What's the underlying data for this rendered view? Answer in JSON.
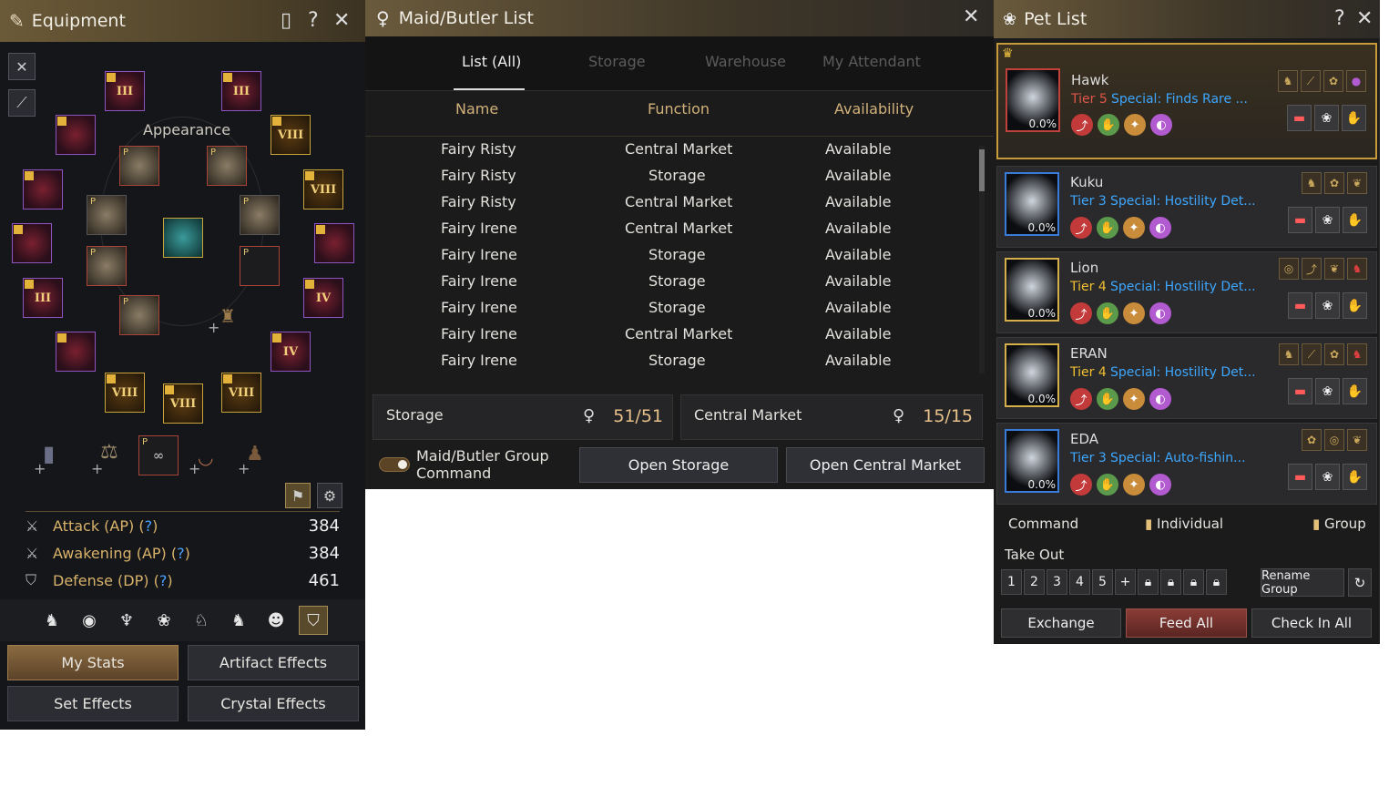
{
  "equipment": {
    "title": "Equipment",
    "appearance_label": "Appearance",
    "slots": [
      {
        "label": "III",
        "kind": "red"
      },
      {
        "label": "III",
        "kind": "red"
      },
      {
        "label": "",
        "kind": "red"
      },
      {
        "label": "VIII",
        "kind": "gold"
      },
      {
        "label": "",
        "kind": "red"
      },
      {
        "label": "VIII",
        "kind": "gold"
      },
      {
        "label": "",
        "kind": "red"
      },
      {
        "label": "",
        "kind": "red"
      },
      {
        "label": "III",
        "kind": "red"
      },
      {
        "label": "IV",
        "kind": "red"
      },
      {
        "label": "",
        "kind": "red"
      },
      {
        "label": "IV",
        "kind": "red"
      },
      {
        "label": "VIII",
        "kind": "gold"
      },
      {
        "label": "VIII",
        "kind": "gold"
      },
      {
        "label": "VIII",
        "kind": "gold"
      }
    ],
    "stats": [
      {
        "label": "Attack (AP)",
        "help": "?",
        "value": "384"
      },
      {
        "label": "Awakening (AP)",
        "help": "?",
        "value": "384"
      },
      {
        "label": "Defense (DP)",
        "help": "?",
        "value": "461"
      }
    ],
    "buttons": {
      "my_stats": "My Stats",
      "artifact_effects": "Artifact Effects",
      "set_effects": "Set Effects",
      "crystal_effects": "Crystal Effects"
    }
  },
  "maid": {
    "title": "Maid/Butler List",
    "tabs": [
      "List (All)",
      "Storage",
      "Warehouse",
      "My Attendant"
    ],
    "columns": [
      "Name",
      "Function",
      "Availability"
    ],
    "rows": [
      {
        "name": "Fairy Risty",
        "function": "Central Market",
        "availability": "Available"
      },
      {
        "name": "Fairy Risty",
        "function": "Storage",
        "availability": "Available"
      },
      {
        "name": "Fairy Risty",
        "function": "Central Market",
        "availability": "Available"
      },
      {
        "name": "Fairy Irene",
        "function": "Central Market",
        "availability": "Available"
      },
      {
        "name": "Fairy Irene",
        "function": "Storage",
        "availability": "Available"
      },
      {
        "name": "Fairy Irene",
        "function": "Storage",
        "availability": "Available"
      },
      {
        "name": "Fairy Irene",
        "function": "Storage",
        "availability": "Available"
      },
      {
        "name": "Fairy Irene",
        "function": "Central Market",
        "availability": "Available"
      },
      {
        "name": "Fairy Irene",
        "function": "Storage",
        "availability": "Available"
      }
    ],
    "storage": {
      "label": "Storage",
      "count": "51/51"
    },
    "market": {
      "label": "Central Market",
      "count": "15/15"
    },
    "group_command": "Maid/Butler Group Command",
    "open_storage": "Open Storage",
    "open_market": "Open Central Market"
  },
  "pet": {
    "title": "Pet List",
    "pets": [
      {
        "name": "Hawk",
        "tier": "Tier 5",
        "tier_color": "#e0564a",
        "special": "Special: Finds Rare ...",
        "pct": "0.0%",
        "frame": "red"
      },
      {
        "name": "Kuku",
        "tier": "Tier 3",
        "tier_color": "#3da7ff",
        "special": "Special: Hostility Det...",
        "pct": "0.0%",
        "frame": "blue"
      },
      {
        "name": "Lion",
        "tier": "Tier 4",
        "tier_color": "#f0c030",
        "special": "Special: Hostility Det...",
        "pct": "0.0%",
        "frame": "gold"
      },
      {
        "name": "ERAN",
        "tier": "Tier 4",
        "tier_color": "#f0c030",
        "special": "Special: Hostility Det...",
        "pct": "0.0%",
        "frame": "gold"
      },
      {
        "name": "EDA",
        "tier": "Tier 3",
        "tier_color": "#3da7ff",
        "special": "Special: Auto-fishin...",
        "pct": "0.0%",
        "frame": "blue"
      }
    ],
    "command": "Command",
    "individual": "Individual",
    "group": "Group",
    "take_out": "Take Out",
    "slots": [
      "1",
      "2",
      "3",
      "4",
      "5"
    ],
    "rename_group": "Rename Group",
    "exchange": "Exchange",
    "feed_all": "Feed All",
    "check_in_all": "Check In All"
  }
}
